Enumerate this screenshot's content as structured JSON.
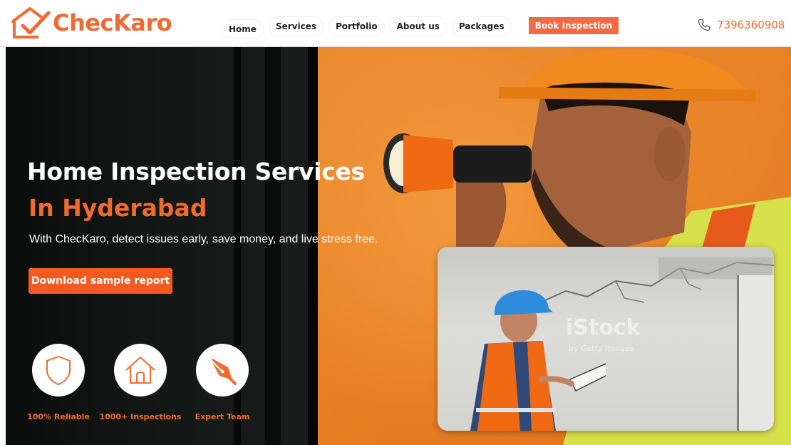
{
  "brand": {
    "name": "ChecKaro",
    "accent": "#f26a33"
  },
  "nav": {
    "items": [
      {
        "label": "Home"
      },
      {
        "label": "Services"
      },
      {
        "label": "Portfolio"
      },
      {
        "label": "About us"
      },
      {
        "label": "Packages"
      }
    ],
    "cta_label": "Book Inspection",
    "phone": "7396360908",
    "phone_icon": "phone-icon"
  },
  "hero": {
    "title": "Home Inspection Services",
    "subtitle": "In Hyderabad",
    "tagline": "With ChecKaro, detect issues early, save money, and live stress free.",
    "button_label": "Download sample report",
    "features": [
      {
        "label": "100% Reliable",
        "icon": "shield-icon"
      },
      {
        "label": "1000+ Inspections",
        "icon": "house-icon"
      },
      {
        "label": "Expert Team",
        "icon": "pen-nib-icon"
      }
    ]
  },
  "video": {
    "watermark": "iStock",
    "watermark_sub": "by Getty Images"
  }
}
